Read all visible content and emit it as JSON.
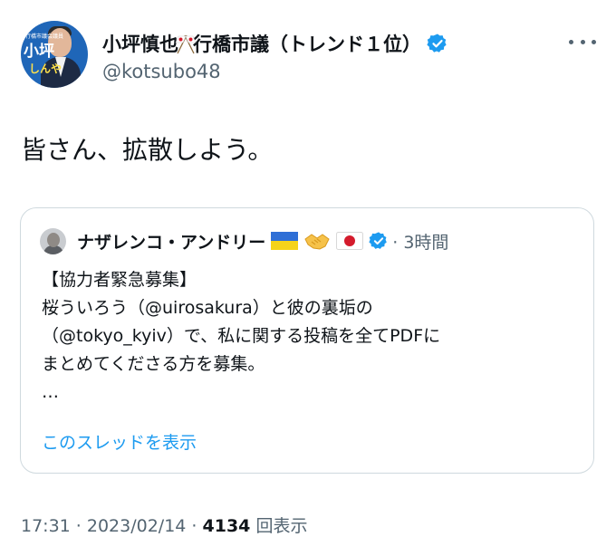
{
  "author": {
    "avatar_top_text": "行橋市議会議員",
    "avatar_name": "小坪",
    "avatar_sub": "しんや",
    "name_part1": "小坪慎也",
    "name_part2": "行橋市議（トレンド１位）",
    "handle": "@kotsubo48",
    "name_flag_icon": "crossed-japan-flags-icon",
    "verified_icon": "verified-badge-icon",
    "more_icon": "more-options-icon"
  },
  "tweet": {
    "text": "皆さん、拡散しよう。"
  },
  "quote": {
    "author_name": "ナザレンコ・アンドリー",
    "emoji_icons": [
      "ukraine-flag-icon",
      "handshake-icon",
      "japan-flag-icon"
    ],
    "time": "· 3時間",
    "lines": [
      "【協力者緊急募集】",
      "桜ういろう（@uirosakura）と彼の裏垢の",
      "（@tokyo_kyiv）で、私に関する投稿を全てPDFに",
      "まとめてくださる方を募集。",
      "…"
    ],
    "show_thread": "このスレッドを表示"
  },
  "meta": {
    "time": "17:31 · 2023/02/14 · ",
    "view_count": "4134",
    "view_label": " 回表示"
  },
  "colors": {
    "text": "#0f1419",
    "secondary": "#536471",
    "link": "#1d9bf0",
    "border": "#cfd9de",
    "verified": "#1d9bf0"
  }
}
